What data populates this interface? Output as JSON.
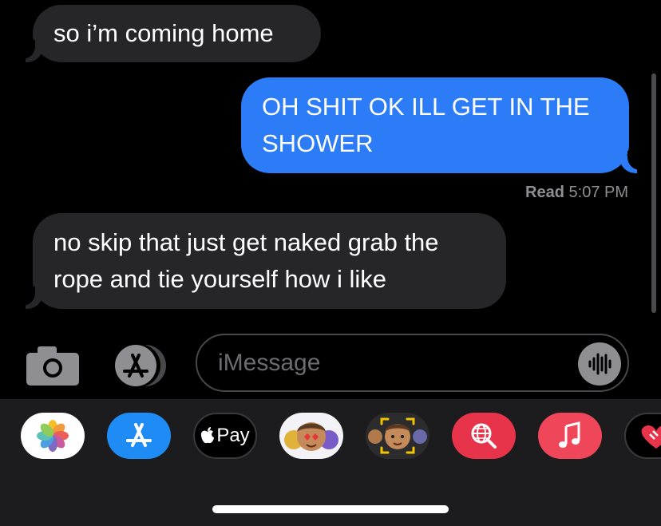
{
  "messages": [
    {
      "direction": "incoming",
      "text": "so i’m coming home"
    },
    {
      "direction": "outgoing",
      "line1": "OH SHIT OK ILL GET IN THE",
      "line2": "SHOWER"
    },
    {
      "direction": "incoming",
      "line1": "no skip that just get naked grab the",
      "line2": "rope and tie yourself how i like"
    }
  ],
  "receipt": {
    "status": "Read",
    "time": "5:07 PM"
  },
  "composer": {
    "placeholder": "iMessage"
  },
  "app_drawer": {
    "apple_pay_label": "Pay",
    "apps": [
      "photos-icon",
      "app-store-icon",
      "apple-pay-icon",
      "memoji-stickers-icon",
      "memoji-camera-icon",
      "web-search-icon",
      "music-icon",
      "heart-sticker-icon"
    ]
  },
  "colors": {
    "incoming_bubble": "#262629",
    "outgoing_bubble": "#2b7cf6",
    "background": "#000000",
    "drawer": "#1c1c1e"
  }
}
